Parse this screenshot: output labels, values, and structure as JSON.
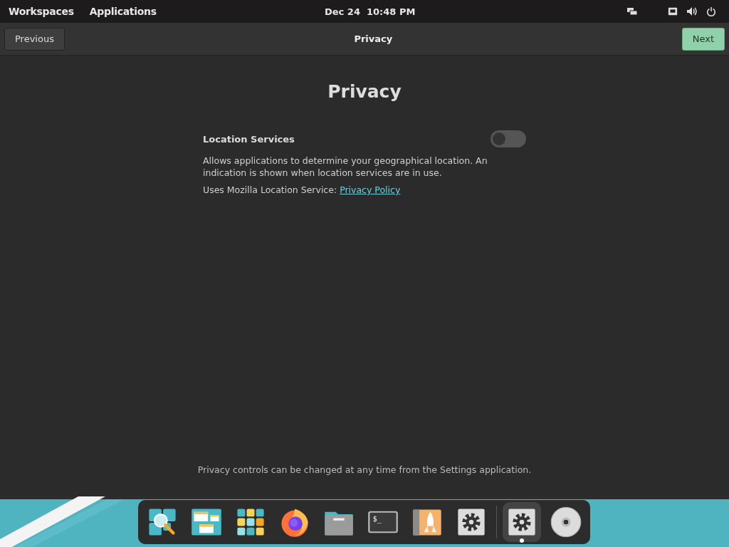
{
  "top_bar": {
    "menus": [
      "Workspaces",
      "Applications"
    ],
    "clock": "Dec 24  10:48 PM"
  },
  "header": {
    "back_button": "Previous",
    "title": "Privacy",
    "next_button": "Next"
  },
  "page": {
    "heading": "Privacy",
    "setting": {
      "label": "Location Services",
      "on": false
    },
    "description": "Allows applications to determine your geographical location. An indication is shown when location services are in use.",
    "service_note": "Uses Mozilla Location Service:",
    "link": "Privacy Policy",
    "footer": "Privacy controls can be changed at any time from the Settings application."
  },
  "dock": [
    {
      "kind": "search",
      "running": false,
      "selected": false
    },
    {
      "kind": "workspaces",
      "running": false,
      "selected": false
    },
    {
      "kind": "grid",
      "running": false,
      "selected": false
    },
    {
      "kind": "firefox",
      "running": false,
      "selected": false
    },
    {
      "kind": "files",
      "running": false,
      "selected": false
    },
    {
      "kind": "terminal",
      "glyph": "$_",
      "running": false,
      "selected": false
    },
    {
      "kind": "rocket",
      "running": false,
      "selected": false
    },
    {
      "kind": "settings",
      "running": false,
      "selected": false
    },
    {
      "kind": "separator"
    },
    {
      "kind": "settings",
      "running": true,
      "selected": true
    },
    {
      "kind": "disc",
      "running": false,
      "selected": false
    }
  ]
}
